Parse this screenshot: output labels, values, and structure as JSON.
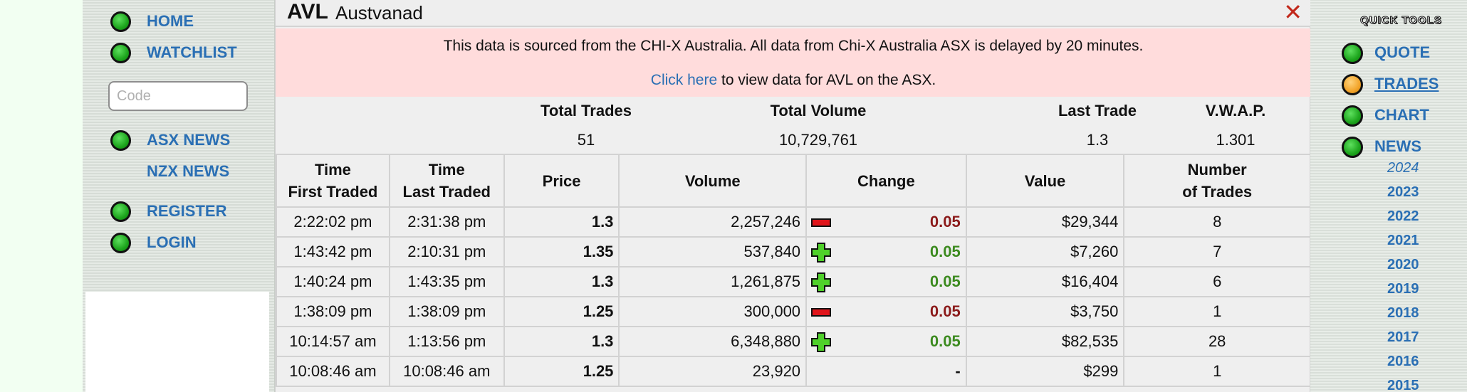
{
  "left_nav": {
    "items": [
      {
        "label": "HOME",
        "dot": true
      },
      {
        "label": "WATCHLIST",
        "dot": true
      },
      {
        "label": "ASX NEWS",
        "dot": true
      },
      {
        "label": "NZX NEWS",
        "dot": false
      },
      {
        "label": "REGISTER",
        "dot": true
      },
      {
        "label": "LOGIN",
        "dot": true
      }
    ],
    "code_placeholder": "Code"
  },
  "panel": {
    "symbol": "AVL",
    "company": "Austvanad",
    "close": "✕",
    "notice_line1": "This data is sourced from the CHI-X Australia. All data from Chi-X Australia ASX is delayed by 20 minutes.",
    "notice_link": "Click here",
    "notice_line2_rest": " to view data for AVL on the ASX."
  },
  "summary": {
    "headers": [
      "Total Trades",
      "Total Volume",
      "Last Trade",
      "V.W.A.P."
    ],
    "values": [
      "51",
      "10,729,761",
      "1.3",
      "1.301"
    ]
  },
  "table": {
    "headers": [
      [
        "Time",
        "First Traded"
      ],
      [
        "Time",
        "Last Traded"
      ],
      [
        "Price",
        ""
      ],
      [
        "Volume",
        ""
      ],
      [
        "Change",
        ""
      ],
      [
        "Value",
        ""
      ],
      [
        "Number",
        "of Trades"
      ]
    ],
    "rows": [
      {
        "first": "2:22:02 pm",
        "last": "2:31:38 pm",
        "price": "1.3",
        "volume": "2,257,246",
        "dir": "down",
        "change": "0.05",
        "value": "$29,344",
        "trades": "8"
      },
      {
        "first": "1:43:42 pm",
        "last": "2:10:31 pm",
        "price": "1.35",
        "volume": "537,840",
        "dir": "up",
        "change": "0.05",
        "value": "$7,260",
        "trades": "7"
      },
      {
        "first": "1:40:24 pm",
        "last": "1:43:35 pm",
        "price": "1.3",
        "volume": "1,261,875",
        "dir": "up",
        "change": "0.05",
        "value": "$16,404",
        "trades": "6"
      },
      {
        "first": "1:38:09 pm",
        "last": "1:38:09 pm",
        "price": "1.25",
        "volume": "300,000",
        "dir": "down",
        "change": "0.05",
        "value": "$3,750",
        "trades": "1"
      },
      {
        "first": "10:14:57 am",
        "last": "1:13:56 pm",
        "price": "1.3",
        "volume": "6,348,880",
        "dir": "up",
        "change": "0.05",
        "value": "$82,535",
        "trades": "28"
      },
      {
        "first": "10:08:46 am",
        "last": "10:08:46 am",
        "price": "1.25",
        "volume": "23,920",
        "dir": "none",
        "change": "-",
        "value": "$299",
        "trades": "1"
      }
    ]
  },
  "right_nav": {
    "title": "QUICK TOOLS",
    "items": [
      {
        "label": "QUOTE",
        "active": false
      },
      {
        "label": "TRADES",
        "active": true
      },
      {
        "label": "CHART",
        "active": false
      },
      {
        "label": "NEWS",
        "active": false
      }
    ],
    "years": [
      "2024",
      "2023",
      "2022",
      "2021",
      "2020",
      "2019",
      "2018",
      "2017",
      "2016",
      "2015"
    ]
  },
  "colors": {
    "link": "#2a6fb4",
    "change_down": "#8b1a1a",
    "change_up": "#3b8a1e",
    "notice_bg": "#ffdcdc",
    "close": "#c2281b"
  }
}
